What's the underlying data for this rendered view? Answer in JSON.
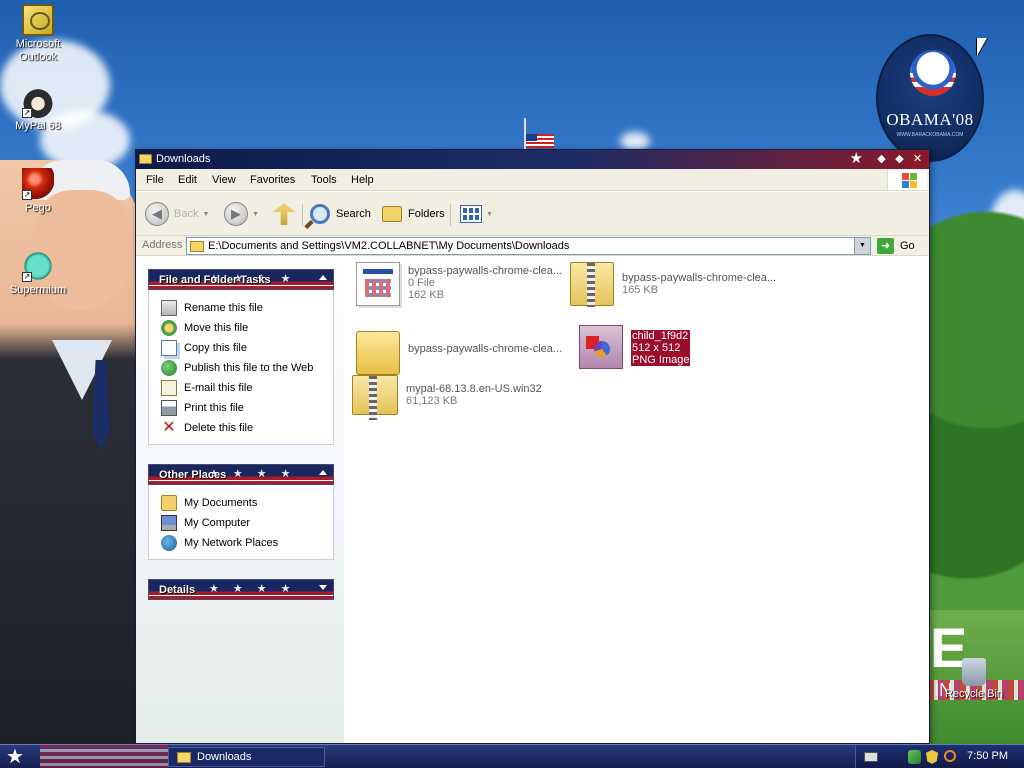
{
  "desktop": {
    "icons": [
      {
        "label": "Microsoft Outlook",
        "icon": "outlook-icon"
      },
      {
        "label": "MyPal 68",
        "icon": "mypal-icon"
      },
      {
        "label": "Pego",
        "icon": "pego-icon"
      },
      {
        "label": "Supermium",
        "icon": "supermium-icon"
      }
    ],
    "recycle_bin": "Recycle Bin",
    "logo": {
      "text": "OBAMA'08",
      "url_text": "WWW.BARACKOBAMA.COM"
    }
  },
  "window": {
    "title": "Downloads",
    "menu": [
      "File",
      "Edit",
      "View",
      "Favorites",
      "Tools",
      "Help"
    ],
    "toolbar": {
      "back": "Back",
      "search": "Search",
      "folders": "Folders"
    },
    "address": {
      "label": "Address",
      "path": "E:\\Documents and Settings\\VM2.COLLABNET\\My Documents\\Downloads",
      "go": "Go"
    },
    "panels": {
      "file_tasks": {
        "title": "File and Folder Tasks",
        "items": [
          {
            "label": "Rename this file",
            "icon": "rename-icon"
          },
          {
            "label": "Move this file",
            "icon": "move-icon"
          },
          {
            "label": "Copy this file",
            "icon": "copy-icon"
          },
          {
            "label": "Publish this file to the Web",
            "icon": "web-publish-icon"
          },
          {
            "label": "E-mail this file",
            "icon": "email-icon"
          },
          {
            "label": "Print this file",
            "icon": "print-icon"
          },
          {
            "label": "Delete this file",
            "icon": "delete-icon"
          }
        ]
      },
      "other_places": {
        "title": "Other Places",
        "items": [
          {
            "label": "My Documents",
            "icon": "my-documents-icon"
          },
          {
            "label": "My Computer",
            "icon": "my-computer-icon"
          },
          {
            "label": "My Network Places",
            "icon": "network-places-icon"
          }
        ]
      },
      "details": {
        "title": "Details"
      }
    },
    "files": [
      {
        "name": "bypass-paywalls-chrome-clea...",
        "line2": "0 File",
        "line3": "162 KB",
        "type": "exe"
      },
      {
        "name": "bypass-paywalls-chrome-clea...",
        "line2": "165 KB",
        "line3": "",
        "type": "zip"
      },
      {
        "name": "bypass-paywalls-chrome-clea...",
        "line2": "",
        "line3": "",
        "type": "folder"
      },
      {
        "name": "child_1f9d2",
        "line2": "512 x 512",
        "line3": "PNG Image",
        "type": "png",
        "selected": true
      },
      {
        "name": "mypal-68.13.8.en-US.win32",
        "line2": "61,123 KB",
        "line3": "",
        "type": "zip"
      }
    ]
  },
  "taskbar": {
    "task_label": "Downloads",
    "clock": "7:50 PM"
  },
  "colors": {
    "title_bar_left": "#0d1b4a",
    "title_bar_right": "#8b1a2a",
    "selection": "#9b0d2a",
    "panel_header": "#1a2660"
  }
}
